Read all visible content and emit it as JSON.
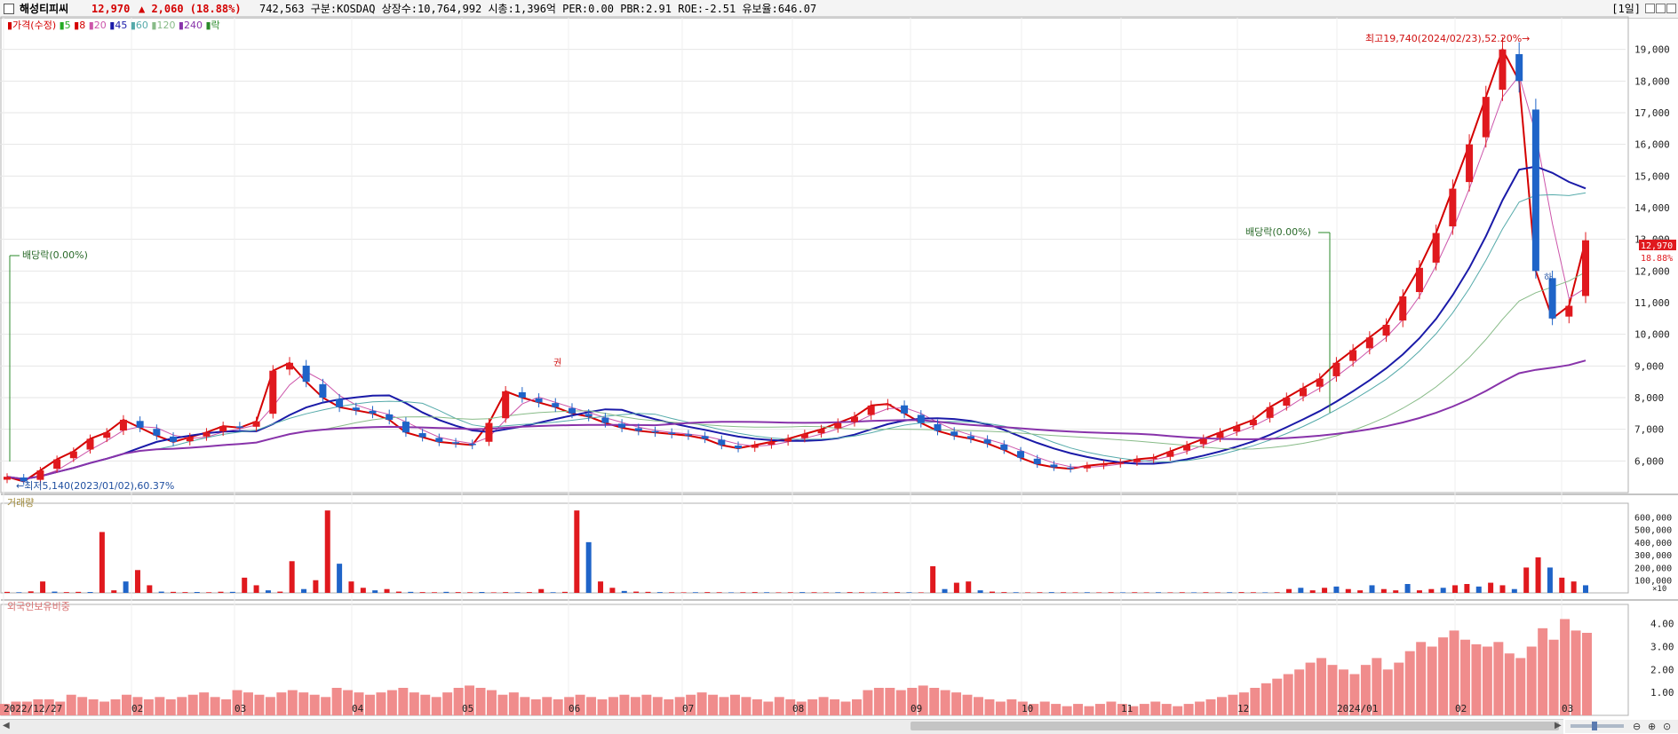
{
  "header": {
    "name": "해성티피씨",
    "price": "12,970",
    "change": "▲ 2,060 (18.88%)",
    "stats": "742,563  구분:KOSDAQ 상장수:10,764,992 시총:1,396억 PER:0.00 PBR:2.91 ROE:-2.51 유보율:646.07",
    "period": "[1일]"
  },
  "legend": {
    "price_items": [
      {
        "text": "가격(수정)",
        "color": "#d40000"
      },
      {
        "text": "5",
        "color": "#22aa22"
      },
      {
        "text": "8",
        "color": "#d40000"
      },
      {
        "text": "20",
        "color": "#cc55aa"
      },
      {
        "text": "45",
        "color": "#1a1aa8"
      },
      {
        "text": "60",
        "color": "#55aaaa"
      },
      {
        "text": "120",
        "color": "#88bb88"
      },
      {
        "text": "240",
        "color": "#8833aa"
      },
      {
        "text": "락",
        "color": "#2a8a2a"
      }
    ],
    "volume": "거래량",
    "foreign": "외국인보유비중"
  },
  "annotations": {
    "high": "최고19,740(2024/02/23),52.20%→",
    "low": "←최저5,140(2023/01/02),60.37%",
    "div1": "배당락(0.00%)",
    "div2": "배당락(0.00%)",
    "mark1": "권",
    "mark2": "하",
    "last_price_tag": "12,970",
    "last_pct_tag": "18.88%"
  },
  "colors": {
    "up": "#e0191e",
    "down": "#1f64c8",
    "grid": "#e6e6e6"
  },
  "chart_data": [
    {
      "type": "candlestick",
      "title": "가격(수정)",
      "y_ticks": [
        6000,
        7000,
        8000,
        9000,
        10000,
        11000,
        12000,
        13000,
        14000,
        15000,
        16000,
        17000,
        18000,
        19000
      ],
      "y_tick_labels": [
        "6,000",
        "7,000",
        "8,000",
        "9,000",
        "10,000",
        "11,000",
        "12,000",
        "13,000",
        "14,000",
        "15,000",
        "16,000",
        "17,000",
        "18,000",
        "19,000"
      ],
      "ylim": [
        5000,
        20000
      ],
      "x_tick_labels": [
        "2022/12/27",
        "02",
        "03",
        "04",
        "05",
        "06",
        "07",
        "08",
        "09",
        "10",
        "11",
        "12",
        "2024/01",
        "02",
        "03"
      ],
      "moving_averages": [
        "5",
        "8",
        "20",
        "45",
        "60",
        "120",
        "240"
      ],
      "closes": [
        5500,
        5350,
        5700,
        6050,
        6300,
        6700,
        6900,
        7300,
        7050,
        6800,
        6600,
        6750,
        6900,
        7100,
        7050,
        7250,
        8850,
        9100,
        8500,
        8000,
        7700,
        7600,
        7500,
        7300,
        6900,
        6750,
        6600,
        6550,
        6500,
        7200,
        8200,
        8000,
        7850,
        7700,
        7500,
        7400,
        7200,
        7050,
        6950,
        6900,
        6850,
        6800,
        6700,
        6500,
        6400,
        6500,
        6600,
        6700,
        6850,
        7000,
        7200,
        7400,
        7750,
        7800,
        7500,
        7200,
        6950,
        6800,
        6700,
        6550,
        6350,
        6100,
        5900,
        5800,
        5750,
        5850,
        5900,
        5950,
        6050,
        6100,
        6300,
        6500,
        6700,
        6900,
        7100,
        7300,
        7700,
        8000,
        8300,
        8600,
        9100,
        9500,
        9900,
        10300,
        11200,
        12100,
        13200,
        14600,
        16000,
        17500,
        19000,
        18000,
        12000,
        10500,
        10900,
        12970
      ],
      "highs": [
        {
          "label": "최고",
          "value": 19740,
          "date": "2024/02/23"
        }
      ],
      "lows": [
        {
          "label": "최저",
          "value": 5140,
          "date": "2023/01/02"
        }
      ],
      "last": 12970
    },
    {
      "type": "bar",
      "title": "거래량",
      "y_ticks": [
        100000,
        200000,
        300000,
        400000,
        500000,
        600000
      ],
      "y_tick_labels": [
        "100,000",
        "200,000",
        "300,000",
        "400,000",
        "500,000",
        "600,000"
      ],
      "unit_label": "×10",
      "ylim": [
        0,
        700000
      ],
      "values": [
        8000,
        5000,
        12000,
        90000,
        10000,
        6000,
        8000,
        7000,
        480000,
        20000,
        90000,
        180000,
        60000,
        10000,
        8000,
        6000,
        7000,
        5000,
        9000,
        8000,
        120000,
        60000,
        20000,
        10000,
        250000,
        30000,
        100000,
        650000,
        230000,
        90000,
        40000,
        20000,
        30000,
        10000,
        8000,
        6000,
        5000,
        8000,
        6000,
        5000,
        7000,
        4000,
        6000,
        5000,
        6000,
        30000,
        5000,
        8000,
        650000,
        400000,
        90000,
        40000,
        15000,
        10000,
        8000,
        6000,
        5000,
        4000,
        5000,
        6000,
        5000,
        4000,
        5000,
        6000,
        5000,
        4000,
        5000,
        6000,
        5000,
        4000,
        5000,
        6000,
        5000,
        4000,
        5000,
        6000,
        5000,
        4000,
        210000,
        30000,
        80000,
        90000,
        20000,
        10000,
        6000,
        5000,
        4000,
        5000,
        6000,
        5000,
        4000,
        5000,
        4000,
        5000,
        4000,
        5000,
        4000,
        5000,
        4000,
        5000,
        4000,
        5000,
        4000,
        5000,
        6000,
        5000,
        4000,
        5000,
        30000,
        40000,
        20000,
        40000,
        50000,
        30000,
        20000,
        60000,
        30000,
        20000,
        70000,
        20000,
        30000,
        40000,
        60000,
        70000,
        50000,
        80000,
        60000,
        30000,
        200000,
        280000,
        200000,
        120000,
        90000,
        60000
      ]
    },
    {
      "type": "bar",
      "title": "외국인보유비중",
      "y_ticks": [
        1,
        2,
        3,
        4
      ],
      "y_tick_labels": [
        "1.00",
        "2.00",
        "3.00",
        "4.00"
      ],
      "ylim": [
        0,
        4.8
      ],
      "values": [
        0.5,
        0.6,
        0.6,
        0.7,
        0.7,
        0.6,
        0.9,
        0.8,
        0.7,
        0.6,
        0.7,
        0.9,
        0.8,
        0.7,
        0.8,
        0.7,
        0.8,
        0.9,
        1.0,
        0.8,
        0.7,
        1.1,
        1.0,
        0.9,
        0.8,
        1.0,
        1.1,
        1.0,
        0.9,
        0.8,
        1.2,
        1.1,
        1.0,
        0.9,
        1.0,
        1.1,
        1.2,
        1.0,
        0.9,
        0.8,
        1.0,
        1.2,
        1.3,
        1.2,
        1.1,
        0.9,
        1.0,
        0.8,
        0.7,
        0.8,
        0.7,
        0.8,
        0.9,
        0.8,
        0.7,
        0.8,
        0.9,
        0.8,
        0.9,
        0.8,
        0.7,
        0.8,
        0.9,
        1.0,
        0.9,
        0.8,
        0.9,
        0.8,
        0.7,
        0.6,
        0.8,
        0.7,
        0.6,
        0.7,
        0.8,
        0.7,
        0.6,
        0.7,
        1.1,
        1.2,
        1.2,
        1.1,
        1.2,
        1.3,
        1.2,
        1.1,
        1.0,
        0.9,
        0.8,
        0.7,
        0.6,
        0.7,
        0.6,
        0.5,
        0.6,
        0.5,
        0.4,
        0.5,
        0.4,
        0.5,
        0.6,
        0.5,
        0.4,
        0.5,
        0.6,
        0.5,
        0.4,
        0.5,
        0.6,
        0.7,
        0.8,
        0.9,
        1.0,
        1.2,
        1.4,
        1.6,
        1.8,
        2.0,
        2.3,
        2.5,
        2.2,
        2.0,
        1.8,
        2.2,
        2.5,
        2.0,
        2.3,
        2.8,
        3.2,
        3.0,
        3.4,
        3.7,
        3.3,
        3.1,
        3.0,
        3.2,
        2.7,
        2.5,
        3.0,
        3.8,
        3.3,
        4.2,
        3.7,
        3.6
      ]
    }
  ]
}
